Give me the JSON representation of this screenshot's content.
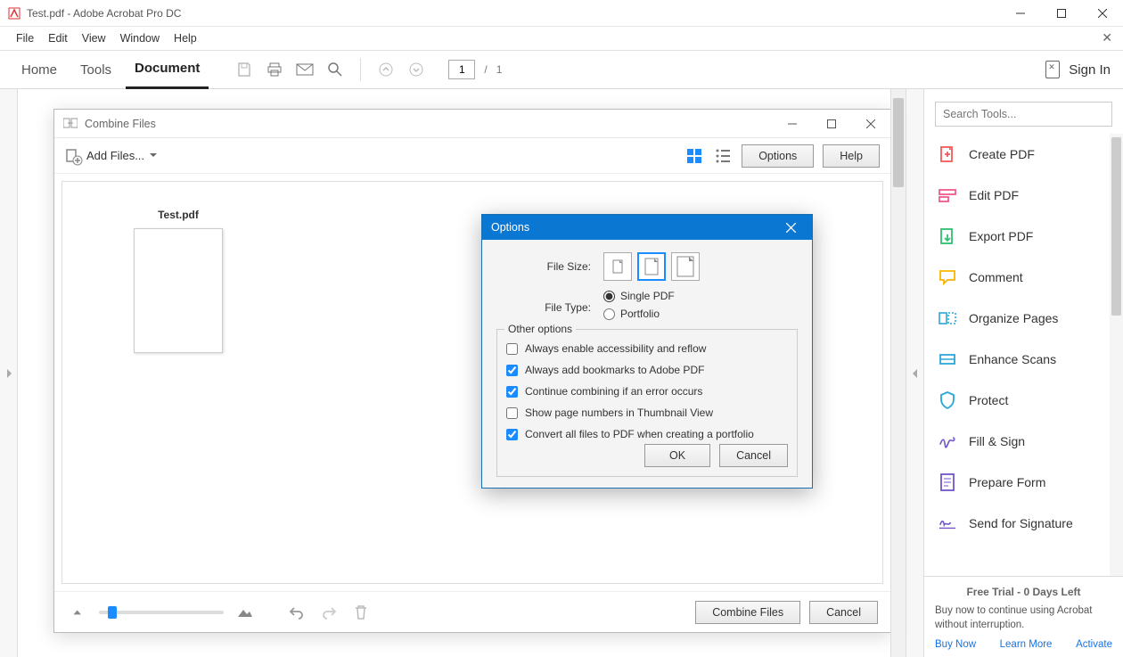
{
  "titlebar": {
    "title": "Test.pdf - Adobe Acrobat Pro DC"
  },
  "menubar": {
    "items": [
      "File",
      "Edit",
      "View",
      "Window",
      "Help"
    ]
  },
  "toolbar": {
    "tabs": {
      "home": "Home",
      "tools": "Tools",
      "document": "Document"
    },
    "page_current": "1",
    "page_total": "1",
    "signin": "Sign In"
  },
  "combine": {
    "title": "Combine Files",
    "add_files": "Add Files...",
    "options_btn": "Options",
    "help_btn": "Help",
    "file_name": "Test.pdf",
    "combine_btn": "Combine Files",
    "cancel_btn": "Cancel"
  },
  "options_dialog": {
    "title": "Options",
    "file_size_label": "File Size:",
    "file_type_label": "File Type:",
    "radio_single": "Single PDF",
    "radio_portfolio": "Portfolio",
    "other_options_legend": "Other options",
    "chk_accessibility": "Always enable accessibility and reflow",
    "chk_bookmarks": "Always add bookmarks to Adobe PDF",
    "chk_continue": "Continue combining if an error occurs",
    "chk_pagenums": "Show page numbers in Thumbnail View",
    "chk_convert": "Convert all files to PDF when creating a portfolio",
    "ok": "OK",
    "cancel": "Cancel",
    "checked": {
      "accessibility": false,
      "bookmarks": true,
      "continue": true,
      "pagenums": false,
      "convert": true
    },
    "file_type_selected": "single",
    "file_size_selected": 1
  },
  "right_panel": {
    "search_placeholder": "Search Tools...",
    "tools": [
      {
        "label": "Create PDF",
        "icon": "create",
        "color": "#f05a5a"
      },
      {
        "label": "Edit PDF",
        "icon": "edit",
        "color": "#f05a8c"
      },
      {
        "label": "Export PDF",
        "icon": "export",
        "color": "#2fbf71"
      },
      {
        "label": "Comment",
        "icon": "comment",
        "color": "#f7b500"
      },
      {
        "label": "Organize Pages",
        "icon": "organize",
        "color": "#2aa7d8"
      },
      {
        "label": "Enhance Scans",
        "icon": "enhance",
        "color": "#2aa7d8"
      },
      {
        "label": "Protect",
        "icon": "protect",
        "color": "#2aa7d8"
      },
      {
        "label": "Fill & Sign",
        "icon": "sign",
        "color": "#7155c8"
      },
      {
        "label": "Prepare Form",
        "icon": "form",
        "color": "#7155c8"
      },
      {
        "label": "Send for Signature",
        "icon": "sendsign",
        "color": "#7155c8"
      }
    ],
    "trial": {
      "title": "Free Trial - 0 Days Left",
      "msg": "Buy now to continue using Acrobat without interruption.",
      "buy": "Buy Now",
      "learn": "Learn More",
      "activate": "Activate"
    }
  }
}
